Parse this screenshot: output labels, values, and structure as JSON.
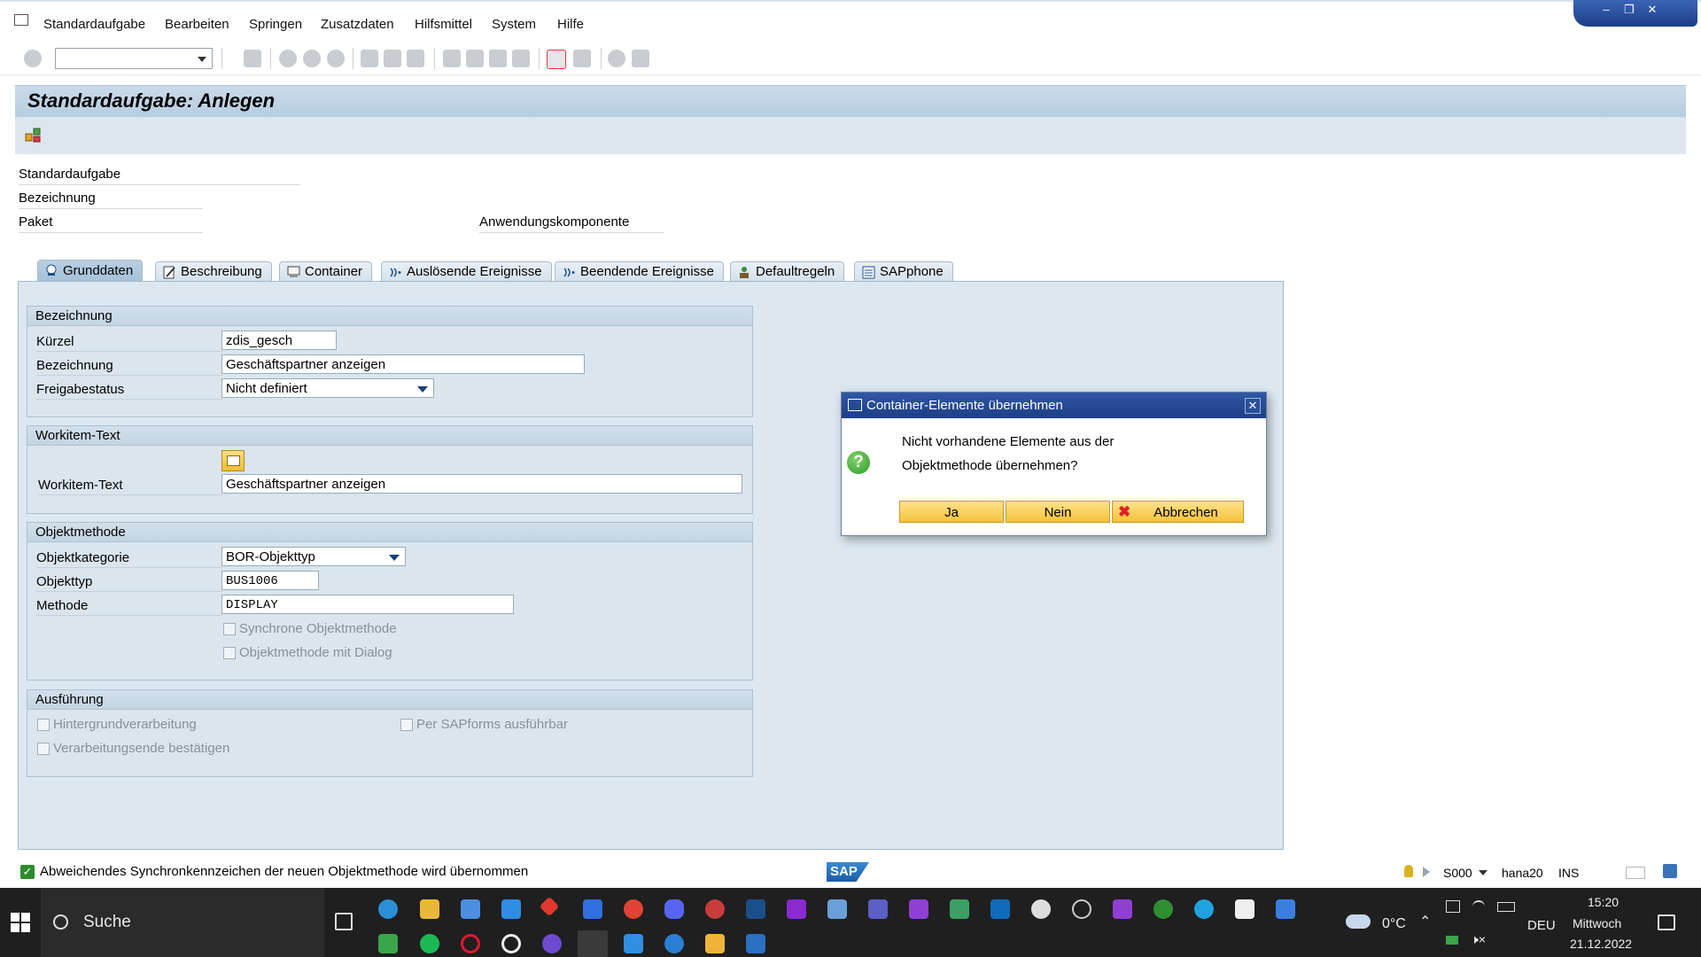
{
  "menu": {
    "items": [
      "Standardaufgabe",
      "Bearbeiten",
      "Springen",
      "Zusatzdaten",
      "Hilfsmittel",
      "System",
      "Hilfe"
    ]
  },
  "title": "Standardaufgabe: Anlegen",
  "header": {
    "fields": [
      "Standardaufgabe",
      "Bezeichnung",
      "Paket"
    ],
    "component_label": "Anwendungskomponente"
  },
  "tabs": [
    {
      "label": "Grunddaten",
      "icon": "task-icon",
      "active": true
    },
    {
      "label": "Beschreibung",
      "icon": "edit-icon",
      "active": false
    },
    {
      "label": "Container",
      "icon": "container-icon",
      "active": false
    },
    {
      "label": "Auslösende Ereignisse",
      "icon": "event-icon",
      "active": false
    },
    {
      "label": "Beendende Ereignisse",
      "icon": "event-icon",
      "active": false
    },
    {
      "label": "Defaultregeln",
      "icon": "rule-icon",
      "active": false
    },
    {
      "label": "SAPphone",
      "icon": "phone-icon",
      "active": false
    }
  ],
  "groups": {
    "bezeichnung": {
      "title": "Bezeichnung",
      "kuerzel_label": "Kürzel",
      "kuerzel_value": "zdis_gesch",
      "bezeichnung_label": "Bezeichnung",
      "bezeichnung_value": "Geschäftspartner anzeigen",
      "freigabe_label": "Freigabestatus",
      "freigabe_value": "Nicht definiert"
    },
    "workitem": {
      "title": "Workitem-Text",
      "label": "Workitem-Text",
      "value": "Geschäftspartner anzeigen"
    },
    "objektmethode": {
      "title": "Objektmethode",
      "kategorie_label": "Objektkategorie",
      "kategorie_value": "BOR-Objekttyp",
      "objekttyp_label": "Objekttyp",
      "objekttyp_value": "BUS1006",
      "methode_label": "Methode",
      "methode_value": "DISPLAY",
      "synchron_label": "Synchrone Objektmethode",
      "dialog_label": "Objektmethode mit Dialog"
    },
    "ausfuehrung": {
      "title": "Ausführung",
      "hintergrund_label": "Hintergrundverarbeitung",
      "sapforms_label": "Per SAPforms ausführbar",
      "bestaetigen_label": "Verarbeitungsende bestätigen"
    }
  },
  "dialog": {
    "title": "Container-Elemente übernehmen",
    "line1": "Nicht vorhandene Elemente aus der",
    "line2": "Objektmethode übernehmen?",
    "yes": "Ja",
    "no": "Nein",
    "cancel": "Abbrechen"
  },
  "status": {
    "message": "Abweichendes Synchronkennzeichen der neuen Objektmethode wird übernommen",
    "sap_logo": "SAP",
    "system": "S000",
    "server": "hana20",
    "mode": "INS"
  },
  "taskbar": {
    "search_label": "Suche",
    "weather": "0°C",
    "language": "DEU",
    "time": "15:20",
    "day": "Mittwoch",
    "date": "21.12.2022"
  },
  "colors": {
    "title_bg": "#c4d7e7",
    "panel_bg": "#dce7f0",
    "dialog_title": "#2a4d98",
    "button_yellow": "#f8cd54",
    "taskbar": "#1f1f1f"
  }
}
